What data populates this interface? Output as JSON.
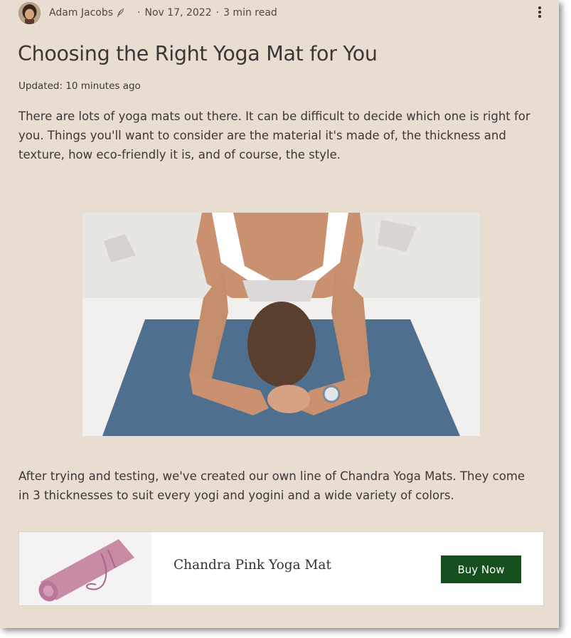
{
  "meta": {
    "author": "Adam Jacobs",
    "separator": "·",
    "date": "Nov 17, 2022",
    "read_time": "3 min read"
  },
  "post": {
    "title": "Choosing the Right Yoga Mat for You",
    "updated": "Updated: 10 minutes ago",
    "intro": " There are lots of yoga mats out there. It can be difficult to decide which one is right for you.  Things you'll want to consider are the material it's made of, the thickness and texture, how eco-friendly it is, and of course, the style.",
    "body": "After trying and testing, we've created our own line of Chandra Yoga Mats. They come in 3 thicknesses to suit every yogi and yogini and a wide variety of colors."
  },
  "product": {
    "name": "Chandra Pink Yoga Mat",
    "cta": "Buy Now"
  },
  "colors": {
    "card_background": "#e9ddd2",
    "button": "#154f1e",
    "yoga_mat": "#4f6f8e",
    "product_mat": "#c98aa6"
  },
  "icons": {
    "author_badge": "quill-icon",
    "more_menu": "more-vertical-icon"
  }
}
